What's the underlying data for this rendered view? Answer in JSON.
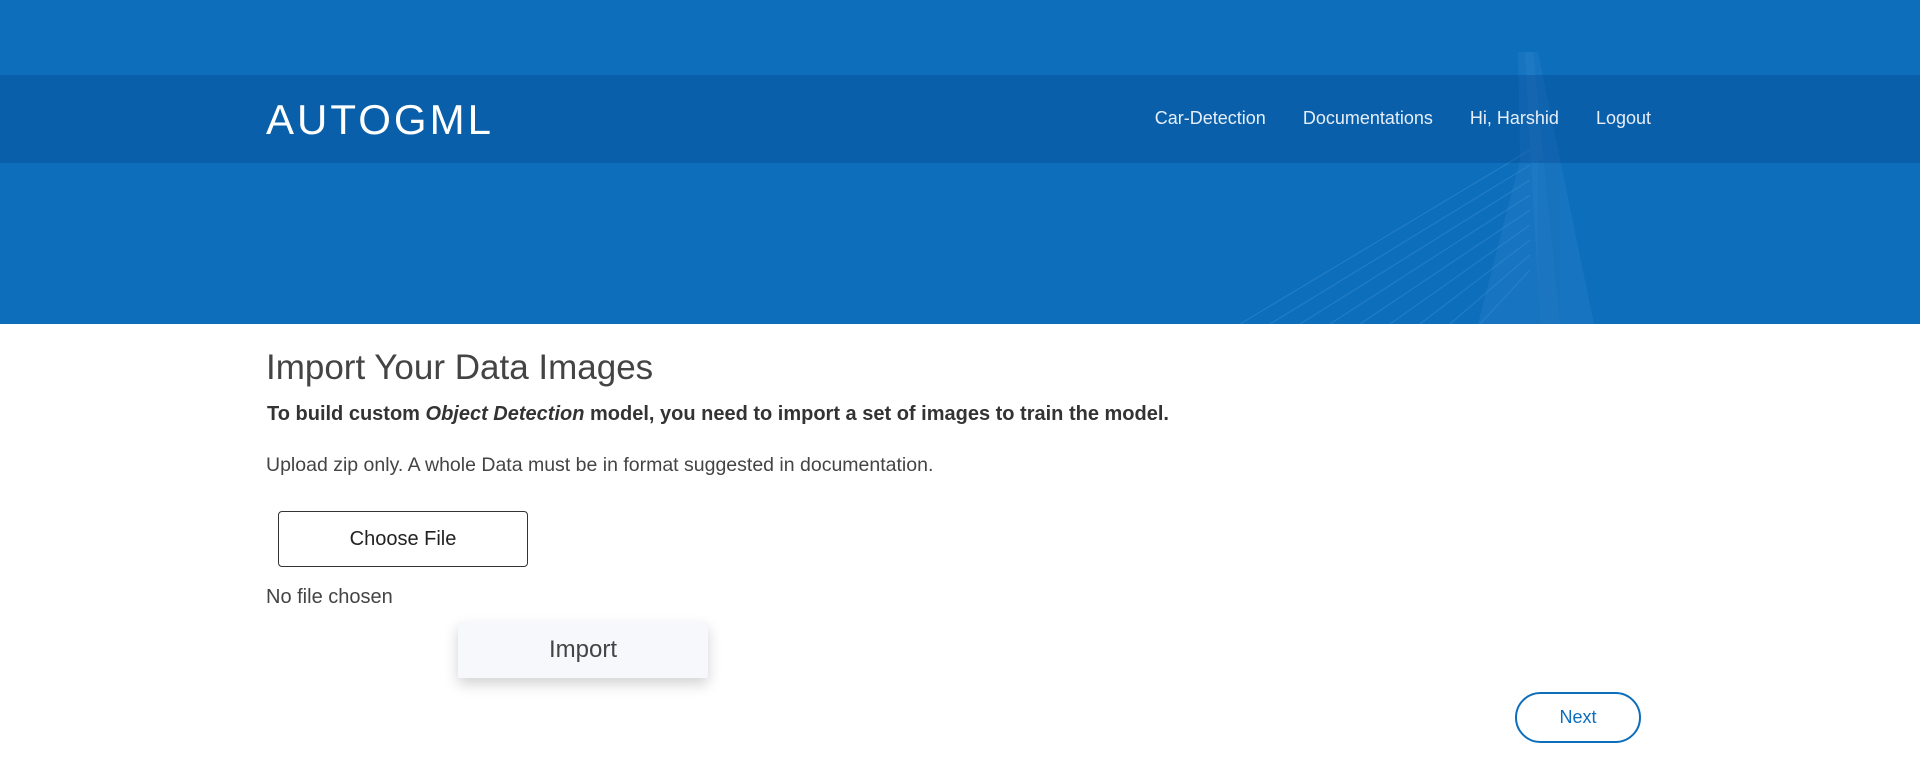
{
  "header": {
    "brand": "AUTOGML",
    "nav": [
      "Car-Detection",
      "Documentations",
      "Hi, Harshid",
      "Logout"
    ],
    "bg_color": "#0d6ebb"
  },
  "main": {
    "title": "Import Your Data Images",
    "intro_prefix": "To build custom ",
    "intro_emphasis": "Object Detection",
    "intro_suffix": " model, you need to import a set of images to train the model.",
    "note": "Upload zip only. A whole Data must be in format suggested in documentation.",
    "file_button_label": "Choose File",
    "file_status": "No file chosen",
    "import_button_label": "Import"
  },
  "footer": {
    "next_label": "Next"
  }
}
